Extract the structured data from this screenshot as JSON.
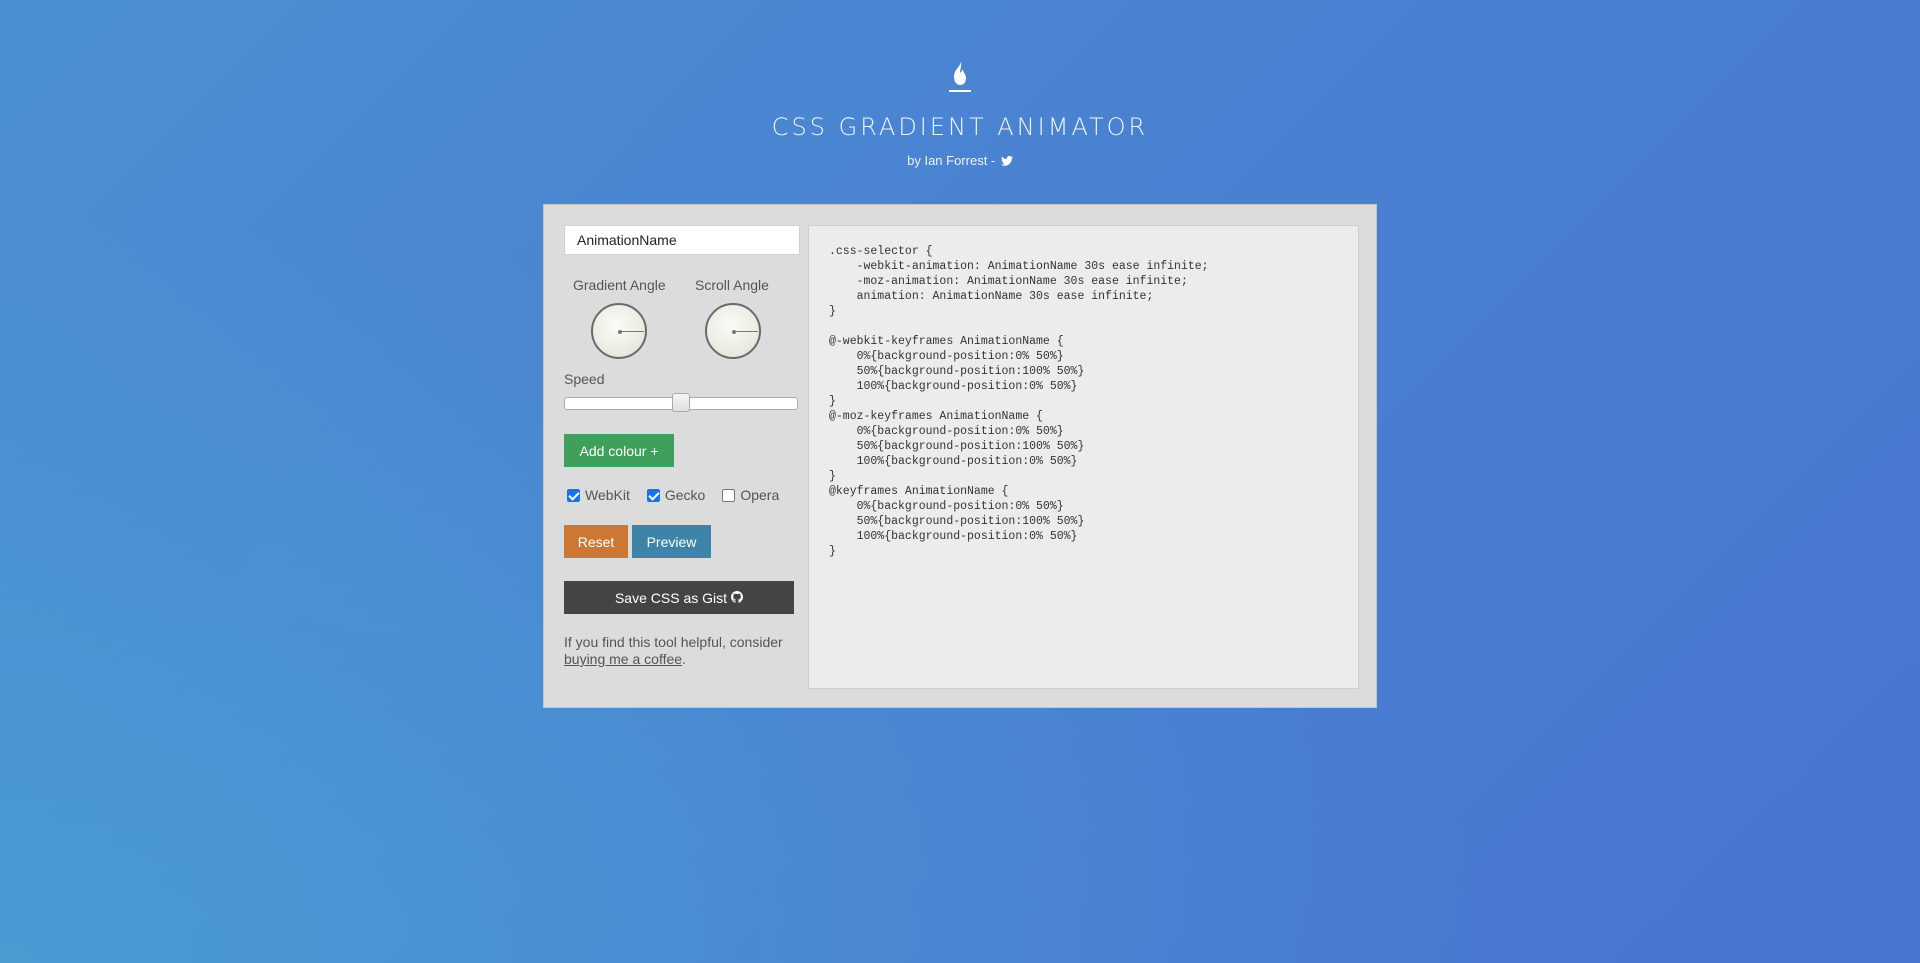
{
  "header": {
    "logo_icon": "flame-icon",
    "title": "CSS GRADIENT ANIMATOR",
    "byline": "by Ian Forrest -",
    "twitter_icon": "twitter-icon"
  },
  "controls": {
    "animation_name_value": "AnimationName",
    "gradient_angle_label": "Gradient Angle",
    "scroll_angle_label": "Scroll Angle",
    "speed_label": "Speed",
    "speed_value_fraction": 0.5,
    "add_colour_label": "Add colour +",
    "checkboxes": [
      {
        "label": "WebKit",
        "checked": true
      },
      {
        "label": "Gecko",
        "checked": true
      },
      {
        "label": "Opera",
        "checked": false
      }
    ],
    "reset_label": "Reset",
    "preview_label": "Preview",
    "save_gist_label": "Save CSS as Gist",
    "github_icon": "github-icon",
    "note_prefix": "If you find this tool helpful, consider",
    "coffee_link": "buying me a coffee",
    "note_suffix": "."
  },
  "colors": {
    "add_colour": "#3fa05b",
    "reset": "#cc7834",
    "preview": "#3d84a8",
    "gist": "#444444"
  },
  "code_output": ".css-selector {\n    -webkit-animation: AnimationName 30s ease infinite;\n    -moz-animation: AnimationName 30s ease infinite;\n    animation: AnimationName 30s ease infinite;\n}\n\n@-webkit-keyframes AnimationName {\n    0%{background-position:0% 50%}\n    50%{background-position:100% 50%}\n    100%{background-position:0% 50%}\n}\n@-moz-keyframes AnimationName {\n    0%{background-position:0% 50%}\n    50%{background-position:100% 50%}\n    100%{background-position:0% 50%}\n}\n@keyframes AnimationName {\n    0%{background-position:0% 50%}\n    50%{background-position:100% 50%}\n    100%{background-position:0% 50%}\n}"
}
